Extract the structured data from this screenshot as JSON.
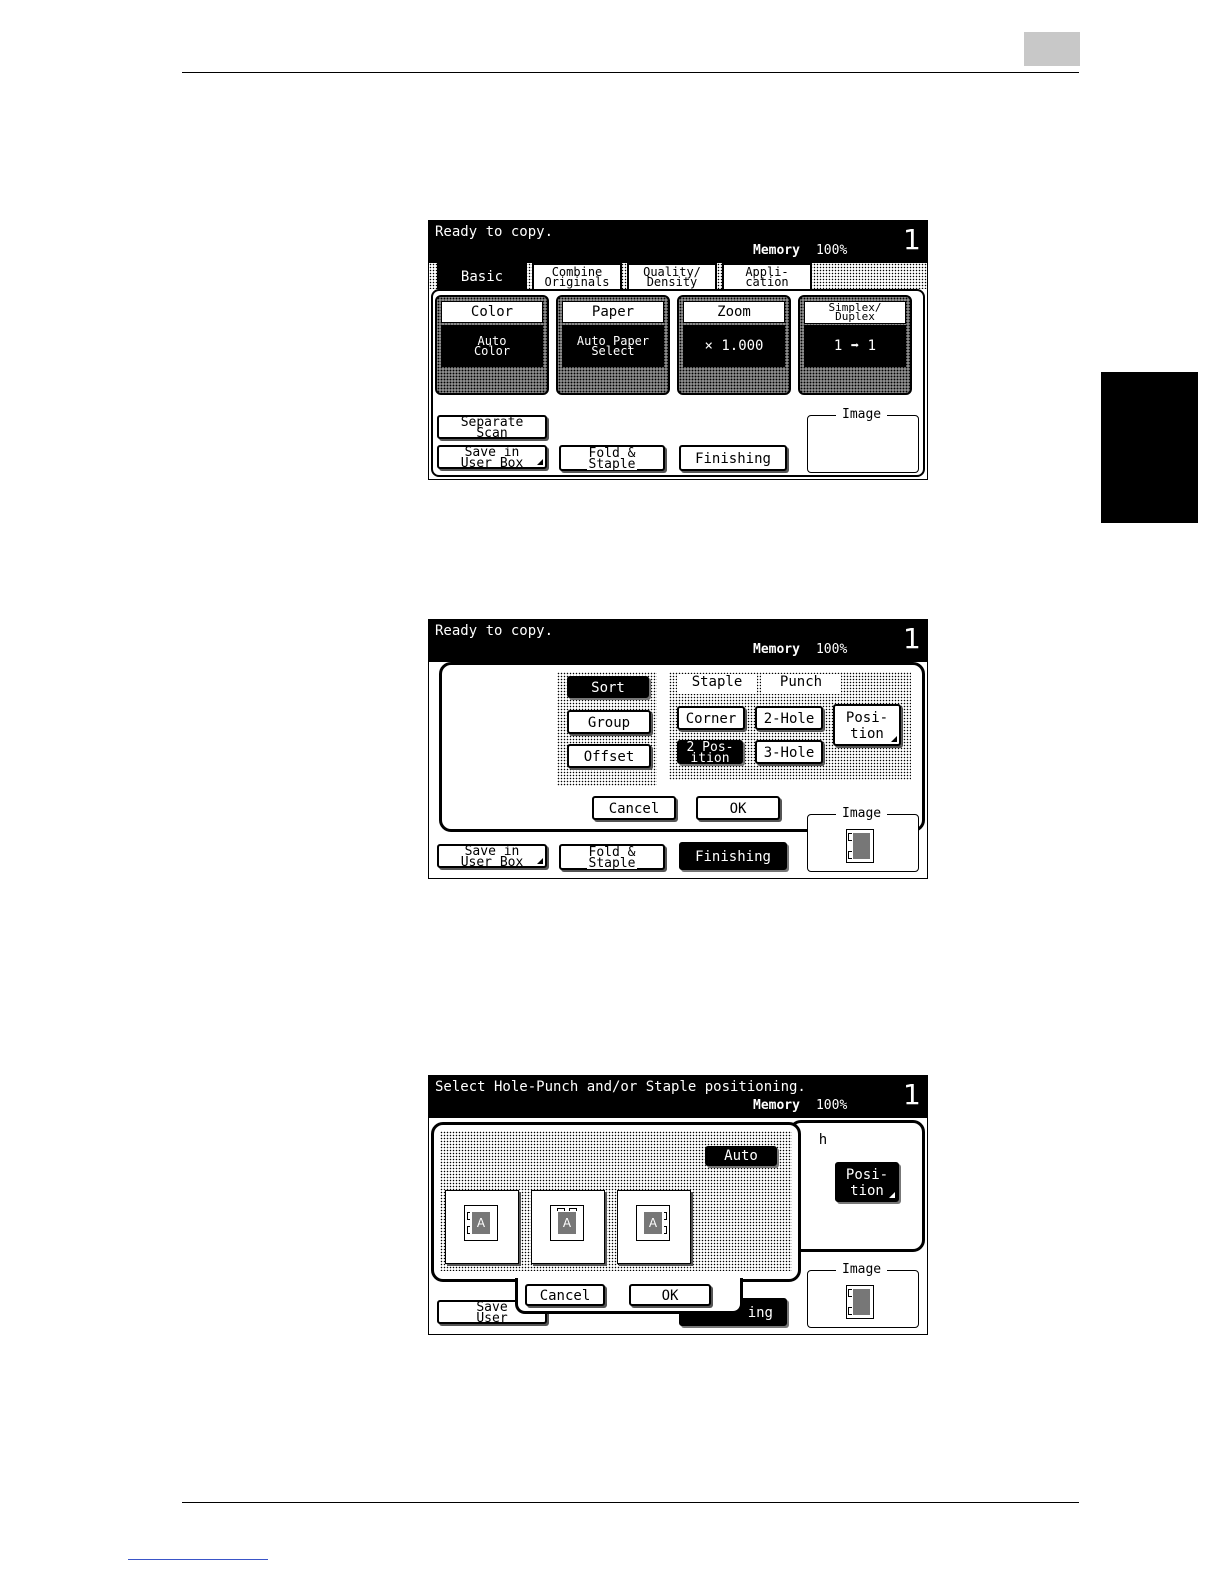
{
  "screen1": {
    "message": "Ready to copy.",
    "memory_label": "Memory",
    "memory_value": "100%",
    "count": "1",
    "tabs": [
      "Basic",
      "Combine\nOriginals",
      "Quality/\nDensity",
      "Appli-\ncation"
    ],
    "functions": [
      {
        "title": "Color",
        "value": "Auto\nColor"
      },
      {
        "title": "Paper",
        "value": "Auto Paper\nSelect"
      },
      {
        "title": "Zoom",
        "value": "× 1.000"
      },
      {
        "title": "Simplex/\nDuplex",
        "value": "1 ➡ 1"
      }
    ],
    "buttons": {
      "separate_scan": "Separate\nScan",
      "save_user_box": "Save in\nUser Box",
      "fold_staple": "Fold &\nStaple",
      "finishing": "Finishing"
    },
    "image_label": "Image"
  },
  "screen2": {
    "message": "Ready to copy.",
    "memory_label": "Memory",
    "memory_value": "100%",
    "count": "1",
    "sort": "Sort",
    "group": "Group",
    "offset": "Offset",
    "staple_label": "Staple",
    "punch_label": "Punch",
    "corner": "Corner",
    "two_position": "2 Pos-\nition",
    "two_hole": "2-Hole",
    "three_hole": "3-Hole",
    "position": "Posi-\ntion",
    "cancel": "Cancel",
    "ok": "OK",
    "save_user_box": "Save in\nUser Box",
    "fold_staple": "Fold &\nStaple",
    "finishing": "Finishing",
    "image_label": "Image"
  },
  "screen3": {
    "message": "Select Hole-Punch and/or Staple positioning.",
    "memory_label": "Memory",
    "memory_value": "100%",
    "count": "1",
    "auto": "Auto",
    "position": "Posi-\ntion",
    "partial_punch": "h",
    "cancel": "Cancel",
    "ok": "OK",
    "save_user": "Save\nUser",
    "finishing_partial": "ing",
    "image_label": "Image",
    "doc_letter": "A"
  }
}
